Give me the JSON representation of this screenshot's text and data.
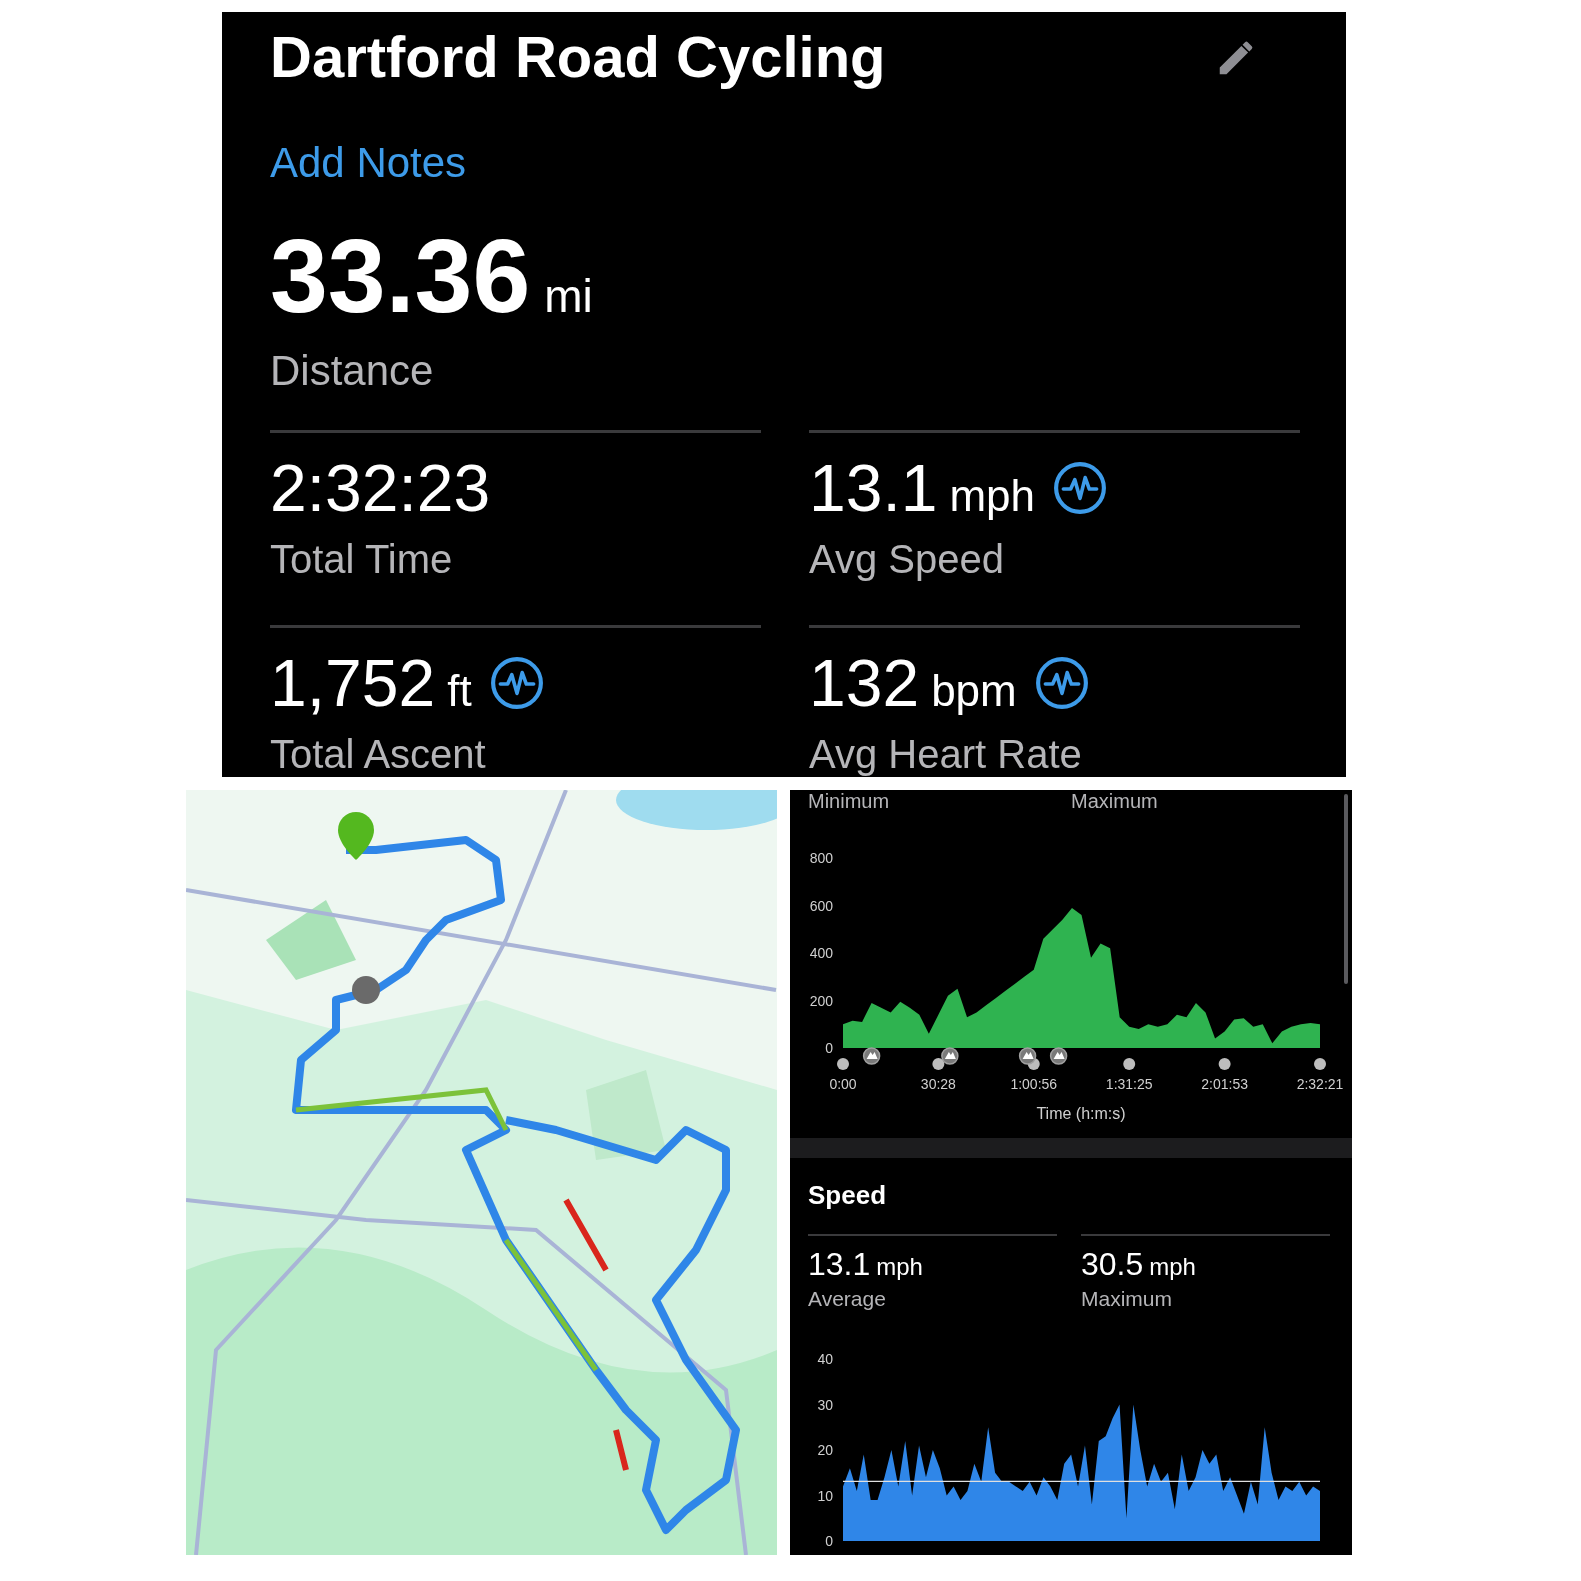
{
  "activity": {
    "title": "Dartford Road Cycling",
    "notes_link": "Add Notes",
    "distance": {
      "value": "33.36",
      "unit": "mi",
      "label": "Distance"
    }
  },
  "stats": [
    {
      "value": "2:32:23",
      "label": "Total Time",
      "insight": false
    },
    {
      "value": "13.1",
      "unit": "mph",
      "label": "Avg Speed",
      "insight": true
    },
    {
      "value": "1,752",
      "unit": "ft",
      "label": "Total Ascent",
      "insight": true
    },
    {
      "value": "132",
      "unit": "bpm",
      "label": "Avg Heart Rate",
      "insight": true
    }
  ],
  "elevation": {
    "legend": [
      "Minimum",
      "Maximum"
    ],
    "chart_data": {
      "type": "area",
      "xlabel": "Time (h:m:s)",
      "xlim": [
        0,
        9141
      ],
      "ylim": [
        0,
        800
      ],
      "yticks": [
        0,
        200,
        400,
        600,
        800
      ],
      "xticks": [
        {
          "value": 0,
          "label": "0:00"
        },
        {
          "value": 1828,
          "label": "30:28"
        },
        {
          "value": 3656,
          "label": "1:00:56"
        },
        {
          "value": 5485,
          "label": "1:31:25"
        },
        {
          "value": 7313,
          "label": "2:01:53"
        },
        {
          "value": 9141,
          "label": "2:32:21"
        }
      ],
      "x": [
        0,
        183,
        366,
        548,
        731,
        914,
        1097,
        1280,
        1463,
        1645,
        1828,
        2011,
        2194,
        2377,
        2559,
        2742,
        2925,
        3108,
        3291,
        3474,
        3656,
        3839,
        4022,
        4205,
        4388,
        4571,
        4753,
        4936,
        5119,
        5302,
        5485,
        5667,
        5850,
        6033,
        6216,
        6399,
        6582,
        6764,
        6947,
        7130,
        7313,
        7496,
        7679,
        7862,
        8044,
        8227,
        8410,
        8593,
        8776,
        8959,
        9141
      ],
      "series": [
        {
          "color": "#2fb350",
          "values": [
            100,
            115,
            110,
            190,
            170,
            150,
            195,
            170,
            140,
            60,
            140,
            220,
            250,
            130,
            150,
            180,
            210,
            240,
            270,
            300,
            330,
            460,
            500,
            540,
            590,
            560,
            380,
            440,
            420,
            130,
            90,
            80,
            100,
            90,
            100,
            140,
            130,
            190,
            150,
            40,
            70,
            120,
            125,
            90,
            100,
            20,
            70,
            90,
            100,
            105,
            100
          ]
        }
      ]
    }
  },
  "speed": {
    "title": "Speed",
    "stats": [
      {
        "value": "13.1",
        "unit": "mph",
        "label": "Average"
      },
      {
        "value": "30.5",
        "unit": "mph",
        "label": "Maximum"
      }
    ],
    "chart_data": {
      "type": "area",
      "ylim": [
        0,
        40
      ],
      "yticks": [
        0,
        10,
        20,
        30,
        40
      ],
      "ref_lines": [
        {
          "axis": "y",
          "value": 13.1
        }
      ],
      "series": [
        {
          "color": "#2f86e8",
          "values": [
            12,
            16,
            11,
            19,
            9,
            9,
            14,
            20,
            12,
            22,
            10,
            21,
            14,
            20,
            16,
            10,
            12,
            9,
            11,
            17,
            13,
            25,
            15,
            13,
            13,
            12,
            11,
            13,
            10,
            14,
            12,
            9,
            17,
            19,
            12,
            21,
            8,
            22,
            23,
            27,
            30,
            5,
            30,
            20,
            12,
            17,
            13,
            15,
            7,
            19,
            11,
            14,
            20,
            17,
            19,
            11,
            14,
            10,
            6,
            13,
            8,
            25,
            15,
            9,
            12,
            11,
            13,
            10,
            12,
            11
          ]
        }
      ]
    }
  }
}
